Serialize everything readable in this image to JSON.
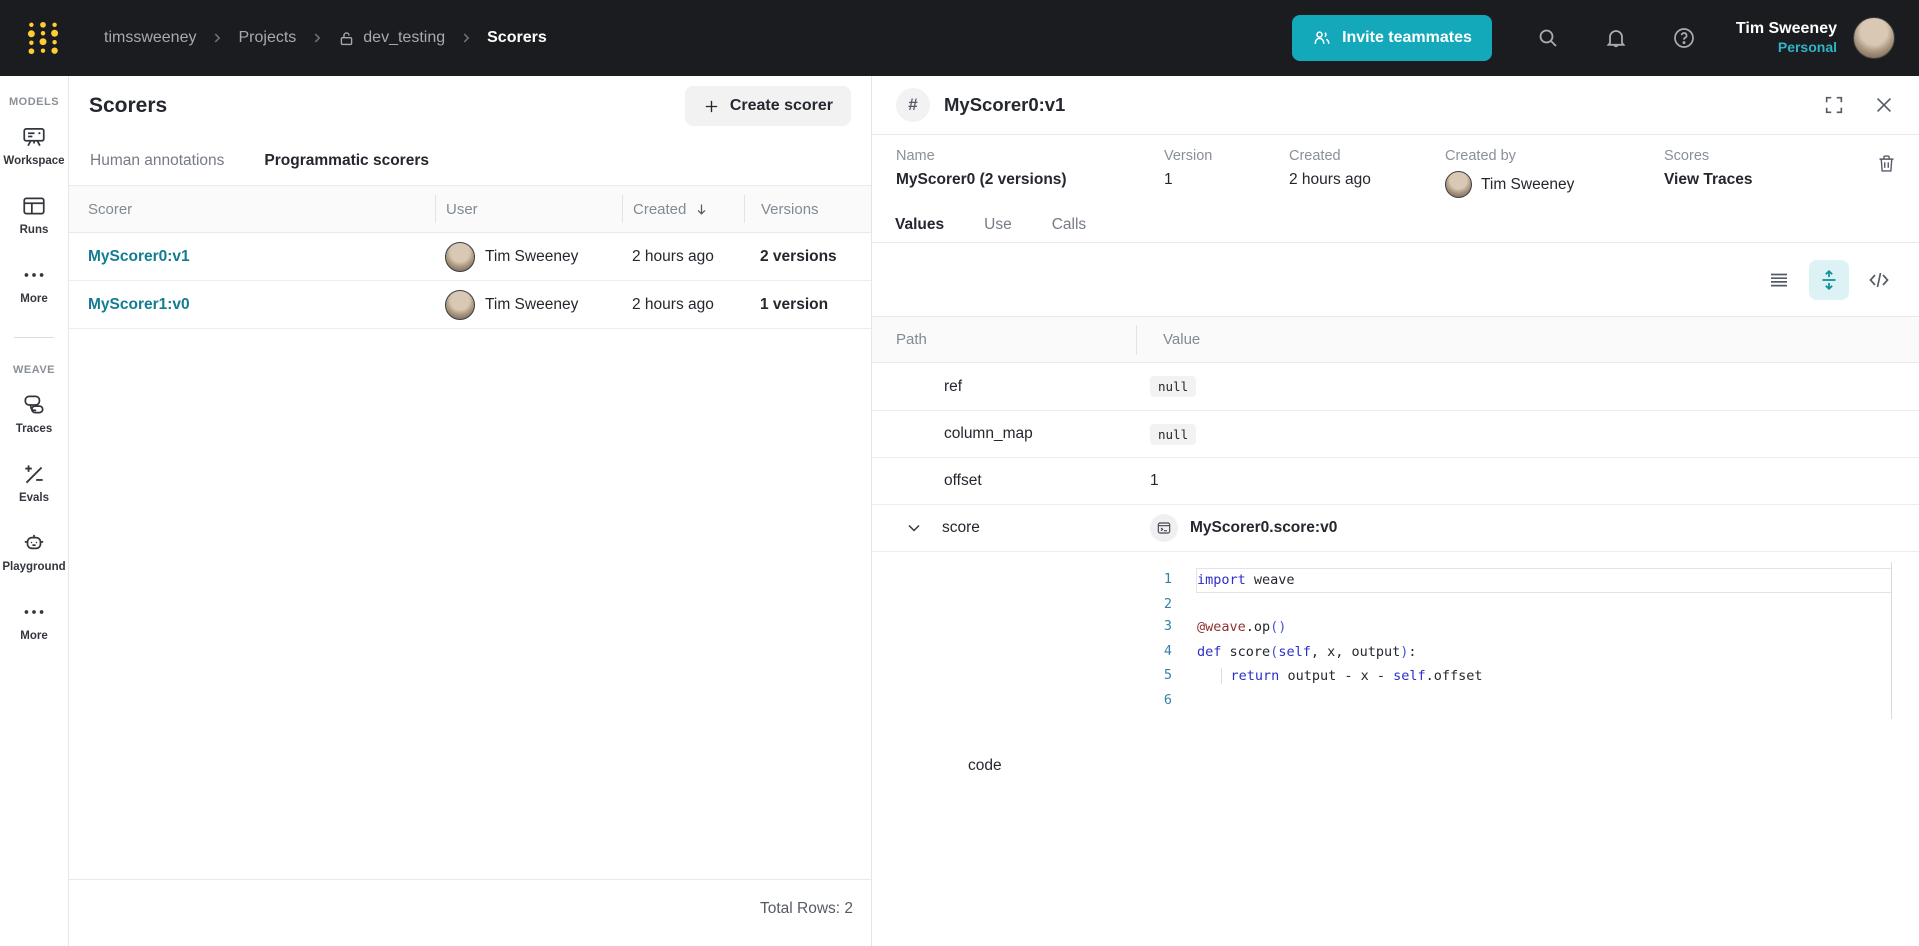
{
  "colors": {
    "navbar_bg": "#1A1C1F",
    "logo_yellow": "#FFCC33",
    "accent_teal": "#13A9BA",
    "link_teal": "#127D91",
    "toolbar_active_bg": "#DCF2F5"
  },
  "navbar": {
    "breadcrumb": {
      "account": "timssweeney",
      "section": "Projects",
      "project": "dev_testing",
      "page": "Scorers"
    },
    "invite_button": "Invite teammates",
    "user": {
      "name": "Tim Sweeney",
      "scope": "Personal"
    }
  },
  "sidebar": {
    "models": {
      "label": "MODELS",
      "items": [
        {
          "label": "Workspace"
        },
        {
          "label": "Runs"
        },
        {
          "label": "More"
        }
      ]
    },
    "weave": {
      "label": "WEAVE",
      "items": [
        {
          "label": "Traces"
        },
        {
          "label": "Evals"
        },
        {
          "label": "Playground"
        },
        {
          "label": "More"
        }
      ]
    }
  },
  "scorers": {
    "title": "Scorers",
    "create_button": "Create scorer",
    "tabs": [
      {
        "label": "Human annotations",
        "active": false
      },
      {
        "label": "Programmatic scorers",
        "active": true
      }
    ],
    "columns": {
      "scorer": "Scorer",
      "user": "User",
      "created": "Created",
      "versions": "Versions"
    },
    "rows": [
      {
        "scorer": "MyScorer0:v1",
        "user": "Tim Sweeney",
        "created": "2 hours ago",
        "versions": "2 versions"
      },
      {
        "scorer": "MyScorer1:v0",
        "user": "Tim Sweeney",
        "created": "2 hours ago",
        "versions": "1 version"
      }
    ],
    "total": "Total Rows: 2"
  },
  "detail": {
    "title": "MyScorer0:v1",
    "meta": {
      "name_label": "Name",
      "name_value": "MyScorer0 (2 versions)",
      "version_label": "Version",
      "version_value": "1",
      "created_label": "Created",
      "created_value": "2 hours ago",
      "created_by_label": "Created by",
      "created_by_value": "Tim Sweeney",
      "scores_label": "Scores",
      "scores_value": "View Traces"
    },
    "tabs": [
      {
        "label": "Values",
        "active": true
      },
      {
        "label": "Use",
        "active": false
      },
      {
        "label": "Calls",
        "active": false
      }
    ],
    "table": {
      "path_col": "Path",
      "value_col": "Value",
      "rows": [
        {
          "path": "ref",
          "value": "null"
        },
        {
          "path": "column_map",
          "value": "null"
        },
        {
          "path": "offset",
          "value": "1"
        },
        {
          "path": "score",
          "value": "MyScorer0.score:v0"
        }
      ],
      "nested_path": "code"
    },
    "code": {
      "lines": [
        {
          "num": "1",
          "hl": true,
          "tokens": [
            [
              "kw",
              "import"
            ],
            [
              "pl",
              " weave"
            ]
          ]
        },
        {
          "num": "2",
          "tokens": []
        },
        {
          "num": "3",
          "tokens": [
            [
              "dec",
              "@weave"
            ],
            [
              "pl",
              ".op"
            ],
            [
              "par",
              "()"
            ]
          ]
        },
        {
          "num": "4",
          "tokens": [
            [
              "kw",
              "def"
            ],
            [
              "pl",
              " score"
            ],
            [
              "par",
              "("
            ],
            [
              "kw",
              "self"
            ],
            [
              "pl",
              ", x, output"
            ],
            [
              "par",
              ")"
            ],
            [
              "pl",
              ":"
            ]
          ]
        },
        {
          "num": "5",
          "tokens": [
            [
              "ind",
              "   "
            ],
            [
              "pl",
              " "
            ],
            [
              "kw",
              "return"
            ],
            [
              "pl",
              " output - x - "
            ],
            [
              "kw",
              "self"
            ],
            [
              "pl",
              ".offset"
            ]
          ]
        },
        {
          "num": "6",
          "tokens": []
        }
      ]
    }
  }
}
